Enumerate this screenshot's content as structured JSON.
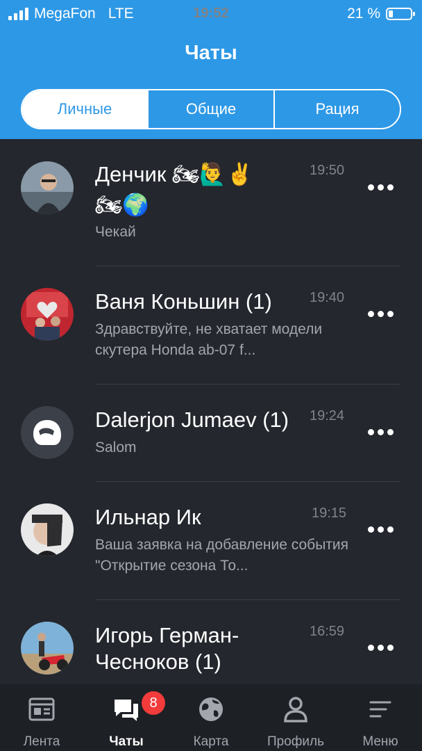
{
  "status_bar": {
    "carrier": "MegaFon",
    "network": "LTE",
    "time": "19:52",
    "battery": "21 %"
  },
  "header": {
    "title": "Чаты"
  },
  "segments": [
    {
      "label": "Личные",
      "selected": true
    },
    {
      "label": "Общие"
    },
    {
      "label": "Рация"
    }
  ],
  "chats": [
    {
      "name": "Денчик 🏍🙋‍♂️✌️",
      "name_line2": "🏍🌍",
      "message": "Чекай",
      "time": "19:50"
    },
    {
      "name": "Ваня Коньшин (1)",
      "message": "Здравствуйте, не хватает модели скутера Honda ab-07 f...",
      "time": "19:40"
    },
    {
      "name": "Dalerjon Jumaev (1)",
      "message": "Salom",
      "time": "19:24"
    },
    {
      "name": "Ильнар Ик",
      "message": "Ваша заявка на добавление события \"Открытие сезона То...",
      "time": "19:15"
    },
    {
      "name": "Игорь Герман-Чесноков (1)",
      "message": "",
      "time": "16:59"
    }
  ],
  "tabbar": [
    {
      "label": "Лента",
      "icon": "feed-icon"
    },
    {
      "label": "Чаты",
      "icon": "chats-icon",
      "badge": "8",
      "active": true
    },
    {
      "label": "Карта",
      "icon": "globe-icon"
    },
    {
      "label": "Профиль",
      "icon": "profile-icon"
    },
    {
      "label": "Меню",
      "icon": "menu-icon"
    }
  ],
  "colors": {
    "accent": "#2d98e6",
    "background": "#24272e",
    "badge": "#f23b3b"
  }
}
